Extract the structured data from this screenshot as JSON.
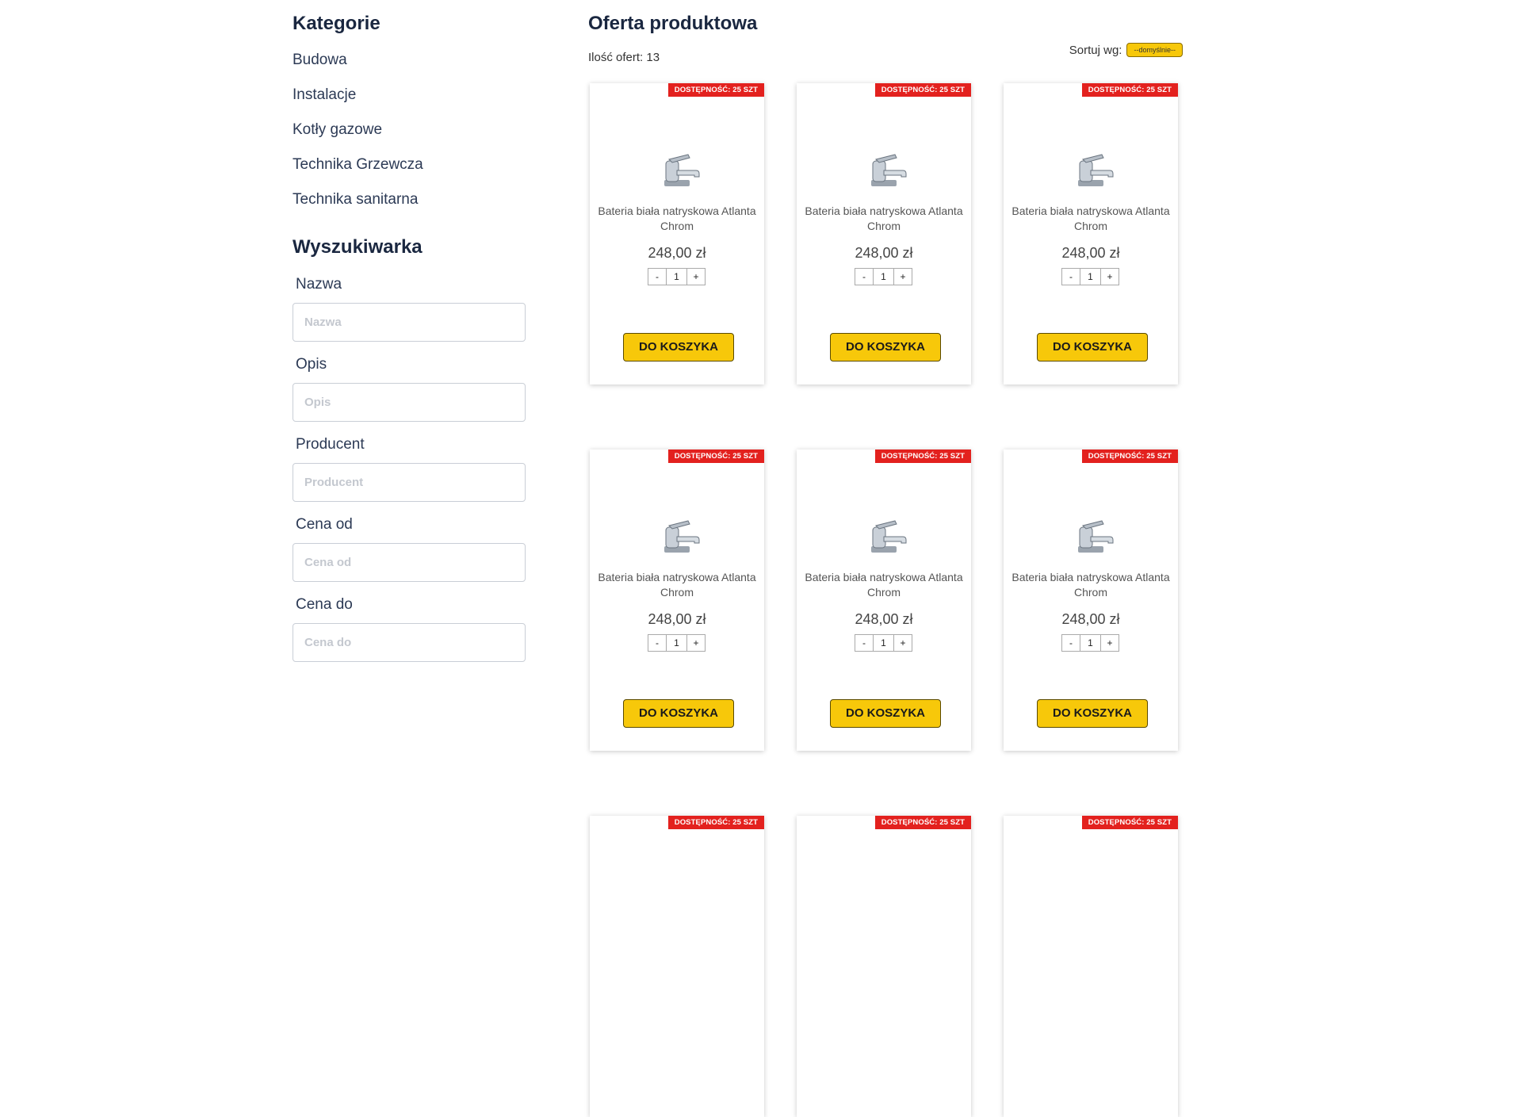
{
  "sidebar": {
    "categories_title": "Kategorie",
    "categories": [
      "Budowa",
      "Instalacje",
      "Kotły gazowe",
      "Technika Grzewcza",
      "Technika sanitarna"
    ],
    "search_title": "Wyszukiwarka",
    "fields": [
      {
        "label": "Nazwa",
        "placeholder": "Nazwa"
      },
      {
        "label": "Opis",
        "placeholder": "Opis"
      },
      {
        "label": "Producent",
        "placeholder": "Producent"
      },
      {
        "label": "Cena od",
        "placeholder": "Cena od"
      },
      {
        "label": "Cena do",
        "placeholder": "Cena do"
      }
    ]
  },
  "main": {
    "title": "Oferta produktowa",
    "offer_count": "Ilość ofert: 13",
    "sort_label": "Sortuj wg:",
    "sort_value": "--domyślnie--"
  },
  "products": [
    {
      "badge": "DOSTĘPNOŚĆ: 25 SZT",
      "name": "Bateria biała natryskowa Atlanta Chrom",
      "price": "248,00 zł",
      "qty_minus": "-",
      "qty": "1",
      "qty_plus": "+",
      "cart": "DO KOSZYKA",
      "icon": "faucet-icon"
    },
    {
      "badge": "DOSTĘPNOŚĆ: 25 SZT",
      "name": "Bateria biała natryskowa Atlanta Chrom",
      "price": "248,00 zł",
      "qty_minus": "-",
      "qty": "1",
      "qty_plus": "+",
      "cart": "DO KOSZYKA",
      "icon": "faucet-icon"
    },
    {
      "badge": "DOSTĘPNOŚĆ: 25 SZT",
      "name": "Bateria biała natryskowa Atlanta Chrom",
      "price": "248,00 zł",
      "qty_minus": "-",
      "qty": "1",
      "qty_plus": "+",
      "cart": "DO KOSZYKA",
      "icon": "faucet-icon"
    },
    {
      "badge": "DOSTĘPNOŚĆ: 25 SZT",
      "name": "Bateria biała natryskowa Atlanta Chrom",
      "price": "248,00 zł",
      "qty_minus": "-",
      "qty": "1",
      "qty_plus": "+",
      "cart": "DO KOSZYKA",
      "icon": "faucet-icon"
    },
    {
      "badge": "DOSTĘPNOŚĆ: 25 SZT",
      "name": "Bateria biała natryskowa Atlanta Chrom",
      "price": "248,00 zł",
      "qty_minus": "-",
      "qty": "1",
      "qty_plus": "+",
      "cart": "DO KOSZYKA",
      "icon": "faucet-icon"
    },
    {
      "badge": "DOSTĘPNOŚĆ: 25 SZT",
      "name": "Bateria biała natryskowa Atlanta Chrom",
      "price": "248,00 zł",
      "qty_minus": "-",
      "qty": "1",
      "qty_plus": "+",
      "cart": "DO KOSZYKA",
      "icon": "faucet-icon"
    },
    {
      "badge": "DOSTĘPNOŚĆ: 25 SZT"
    },
    {
      "badge": "DOSTĘPNOŚĆ: 25 SZT"
    },
    {
      "badge": "DOSTĘPNOŚĆ: 25 SZT"
    }
  ],
  "colors": {
    "accent": "#f7c80a",
    "badge": "#e3211e",
    "heading": "#1a2740"
  }
}
